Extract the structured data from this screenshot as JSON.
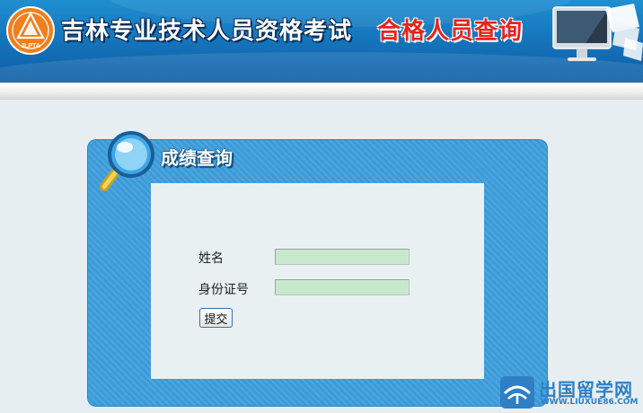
{
  "header": {
    "site_title": "吉林专业技术人员资格考试",
    "page_subtitle": "合格人员查询",
    "logo_text": "JLPTA",
    "colors": {
      "banner": "#1676bd",
      "subtitle": "#e8221b"
    }
  },
  "panel": {
    "title": "成绩查询",
    "icon": "magnifier-icon",
    "color": "#3b9bd8"
  },
  "form": {
    "name_label": "姓名",
    "name_value": "",
    "id_label": "身份证号",
    "id_value": "",
    "submit_label": "提交",
    "field_color": "#c8e8cd"
  },
  "watermark": {
    "text": "出国留学网",
    "url": "WWW.LIUXUE86.COM"
  }
}
